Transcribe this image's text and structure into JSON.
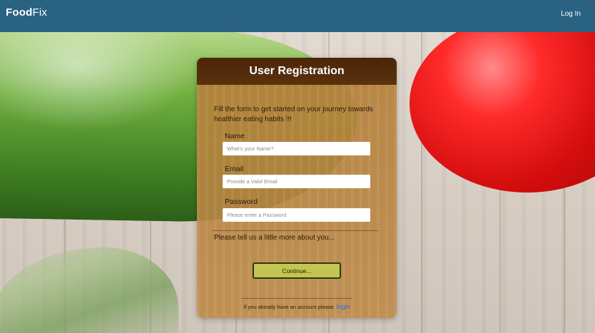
{
  "header": {
    "brand_food": "Food",
    "brand_fix": "Fix",
    "login_label": "Log In"
  },
  "card": {
    "title": "User Registration",
    "intro": "Fill the form to get started on your journey towards healthier eating habits !!!",
    "fields": [
      {
        "label": "Name",
        "placeholder": "What's your Name?"
      },
      {
        "label": "Email",
        "placeholder": "Provide a Valid Email"
      },
      {
        "label": "Password",
        "placeholder": "Please enter a Password"
      }
    ],
    "more_prompt": "Please tell us a little more about you...",
    "continue_label": "Continue...",
    "footer_text": "If you already have an account please",
    "footer_link": "login"
  },
  "colors": {
    "header_bg": "#2a6282",
    "card_header_bg": "#4a2506",
    "button_bg": "#c3c552",
    "link": "#2a6fd6"
  }
}
